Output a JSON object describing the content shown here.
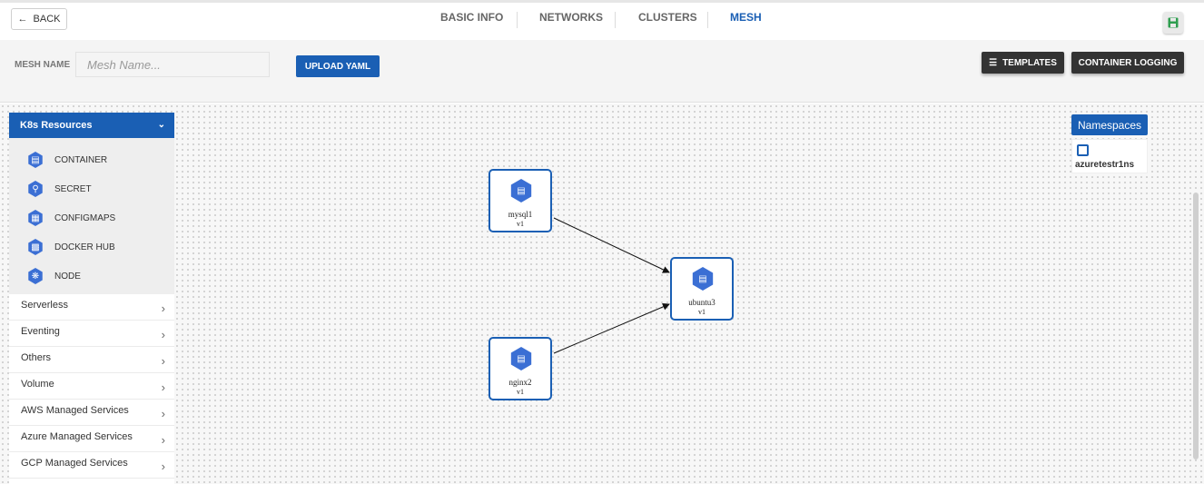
{
  "header": {
    "back_label": "BACK",
    "tabs": [
      {
        "label": "BASIC INFO",
        "active": false
      },
      {
        "label": "NETWORKS",
        "active": false
      },
      {
        "label": "CLUSTERS",
        "active": false
      },
      {
        "label": "MESH",
        "active": true
      }
    ],
    "save_icon": "save-icon"
  },
  "toolbar": {
    "mesh_name_label": "MESH NAME",
    "mesh_name_placeholder": "Mesh Name...",
    "mesh_name_value": "",
    "upload_label": "UPLOAD YAML",
    "templates_label": "TEMPLATES",
    "container_logging_label": "CONTAINER LOGGING"
  },
  "sidebar": {
    "header": "K8s Resources",
    "resources": [
      {
        "label": "CONTAINER",
        "icon": "container-icon"
      },
      {
        "label": "SECRET",
        "icon": "key-icon"
      },
      {
        "label": "CONFIGMAPS",
        "icon": "configmap-icon"
      },
      {
        "label": "DOCKER HUB",
        "icon": "docker-icon"
      },
      {
        "label": "NODE",
        "icon": "node-icon"
      }
    ],
    "categories": [
      {
        "label": "Serverless"
      },
      {
        "label": "Eventing"
      },
      {
        "label": "Others"
      },
      {
        "label": "Volume"
      },
      {
        "label": "AWS Managed Services"
      },
      {
        "label": "Azure Managed Services"
      },
      {
        "label": "GCP Managed Services"
      }
    ]
  },
  "namespaces": {
    "button_label": "Namespaces",
    "items": [
      {
        "label": "azuretestr1ns"
      }
    ]
  },
  "graph": {
    "nodes": [
      {
        "id": "mysql1",
        "name": "mysql1",
        "version": "v1"
      },
      {
        "id": "ubuntu3",
        "name": "ubuntu3",
        "version": "v1"
      },
      {
        "id": "nginx2",
        "name": "nginx2",
        "version": "v1"
      }
    ],
    "edges": [
      {
        "from": "mysql1",
        "to": "ubuntu3"
      },
      {
        "from": "nginx2",
        "to": "ubuntu3"
      }
    ]
  },
  "colors": {
    "accent": "#1a5fb4",
    "dark_button": "#333333",
    "save_green": "#2e9e4f"
  }
}
